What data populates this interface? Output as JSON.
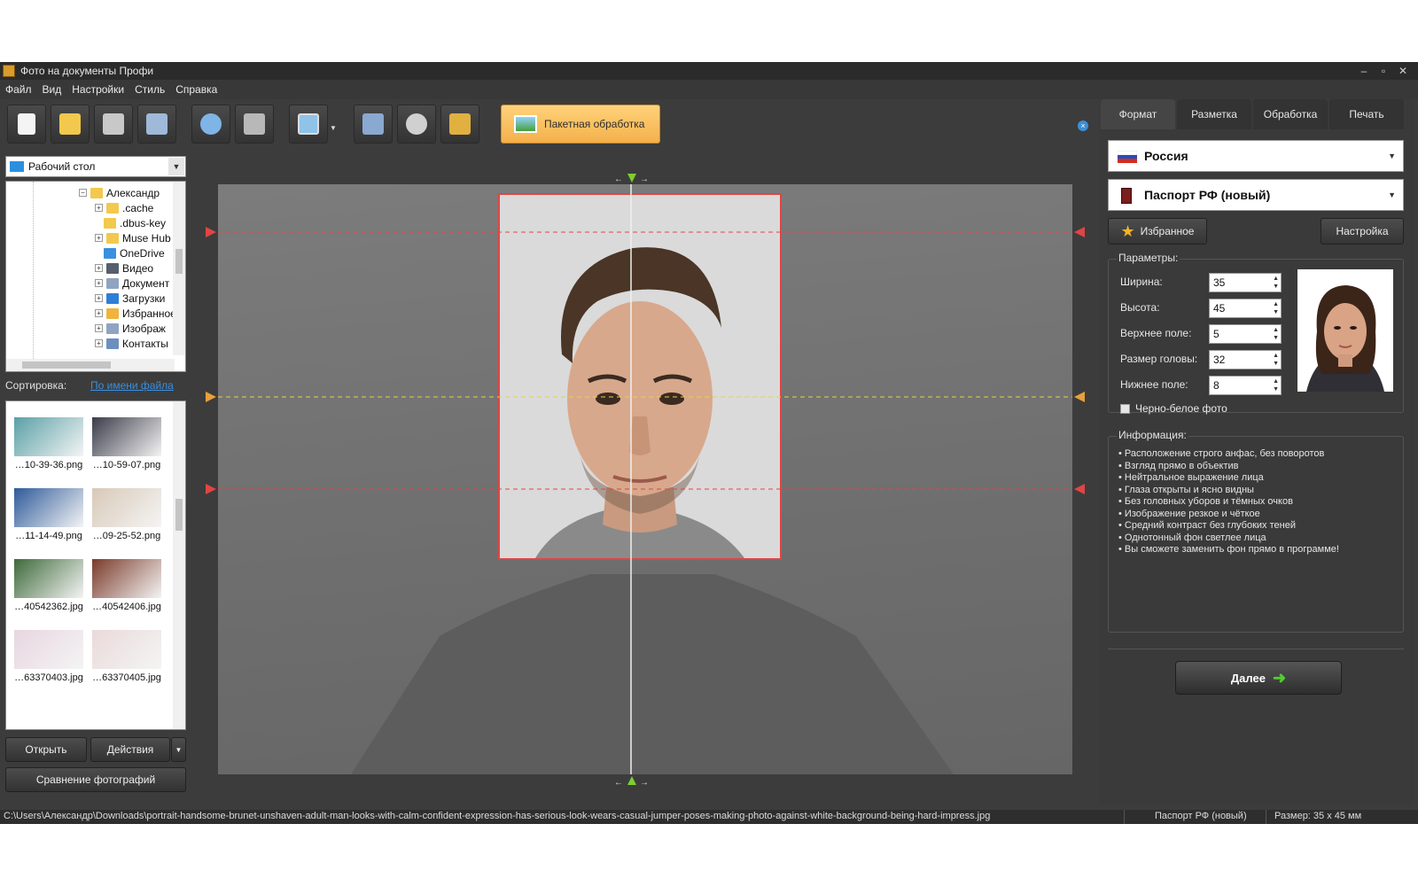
{
  "window": {
    "title": "Фото на документы Профи",
    "controls": [
      "–",
      "▫",
      "✕"
    ]
  },
  "menu": [
    "Файл",
    "Вид",
    "Настройки",
    "Стиль",
    "Справка"
  ],
  "toolbar": {
    "batch_label": "Пакетная обработка",
    "close_symbol": "×",
    "buttons": [
      "new-file-icon",
      "open-folder-icon",
      "save-icon",
      "print-icon",
      "load-photo-icon",
      "camera-icon",
      "slideshow-icon",
      "box-icon",
      "film-icon",
      "printer-export-icon"
    ]
  },
  "left": {
    "location": "Рабочий стол",
    "location_arrow": "▼",
    "tree": [
      {
        "label": "Александр",
        "sign": "⊟",
        "icon": "folder-icon",
        "color": "#f2c94c"
      },
      {
        "label": ".cache",
        "sign": "⊞",
        "icon": "folder-icon",
        "color": "#f2c94c"
      },
      {
        "label": ".dbus-key",
        "sign": "",
        "icon": "folder-icon",
        "color": "#f2c94c"
      },
      {
        "label": "Muse Hub",
        "sign": "⊞",
        "icon": "folder-icon",
        "color": "#f2c94c"
      },
      {
        "label": "OneDrive",
        "sign": "",
        "icon": "cloud-icon",
        "color": "#3a8fe0"
      },
      {
        "label": "Видео",
        "sign": "⊞",
        "icon": "video-folder-icon",
        "color": "#555f6e"
      },
      {
        "label": "Документ",
        "sign": "⊞",
        "icon": "documents-icon",
        "color": "#8fa4c2"
      },
      {
        "label": "Загрузки",
        "sign": "⊞",
        "icon": "downloads-icon",
        "color": "#2d7fd6"
      },
      {
        "label": "Избранное",
        "sign": "⊞",
        "icon": "star-icon",
        "color": "#f0b43c"
      },
      {
        "label": "Изображ",
        "sign": "⊞",
        "icon": "pictures-icon",
        "color": "#8fa4c2"
      },
      {
        "label": "Контакты",
        "sign": "⊞",
        "icon": "contacts-icon",
        "color": "#6d8fbf"
      }
    ],
    "sort_label": "Сортировка:",
    "sort_value": "По имени файла",
    "thumbnails": [
      {
        "caption": "…10-39-36.png",
        "color": "#5aa0a6"
      },
      {
        "caption": "…10-59-07.png",
        "color": "#3c3c4a"
      },
      {
        "caption": "…11-14-49.png",
        "color": "#2e5a9a"
      },
      {
        "caption": "…09-25-52.png",
        "color": "#d8c9b8"
      },
      {
        "caption": "…40542362.jpg",
        "color": "#3e6a3a"
      },
      {
        "caption": "…40542406.jpg",
        "color": "#7a3a2a"
      },
      {
        "caption": "…63370403.jpg",
        "color": "#e8d6e0"
      },
      {
        "caption": "…63370405.jpg",
        "color": "#eadada"
      }
    ],
    "open_label": "Открыть",
    "actions_label": "Действия",
    "actions_arrow": "▼",
    "compare_label": "Сравнение фотографий"
  },
  "right": {
    "tabs": [
      "Формат",
      "Разметка",
      "Обработка",
      "Печать"
    ],
    "country": "Россия",
    "document": "Паспорт РФ (новый)",
    "favorites_label": "Избранное",
    "settings_label": "Настройка",
    "params_title": "Параметры:",
    "params": [
      {
        "label": "Ширина:",
        "value": "35"
      },
      {
        "label": "Высота:",
        "value": "45"
      },
      {
        "label": "Верхнее поле:",
        "value": "5"
      },
      {
        "label": "Размер головы:",
        "value": "32"
      },
      {
        "label": "Нижнее поле:",
        "value": "8"
      }
    ],
    "bw_label": "Черно-белое фото",
    "bw_checked": false,
    "info_title": "Информация:",
    "info": [
      "Расположение строго анфас, без поворотов",
      "Взгляд прямо в объектив",
      "Нейтральное выражение лица",
      "Глаза открыты и ясно видны",
      "Без головных уборов и тёмных очков",
      "Изображение резкое и чёткое",
      "Средний контраст без глубоких теней",
      "Однотонный фон светлее лица",
      "Вы сможете заменить фон прямо в программе!"
    ],
    "next_label": "Далее"
  },
  "status": {
    "path": "C:\\Users\\Александр\\Downloads\\portrait-handsome-brunet-unshaven-adult-man-looks-with-calm-confident-expression-has-serious-look-wears-casual-jumper-poses-making-photo-against-white-background-being-hard-impress.jpg",
    "doc": "Паспорт РФ (новый)",
    "size": "Размер: 35 x 45 мм"
  },
  "colors": {
    "accent": "#f4b14c",
    "guide_red": "#e04545",
    "guide_yellow": "#e8d24a",
    "marker_green": "#7ccf2e"
  }
}
